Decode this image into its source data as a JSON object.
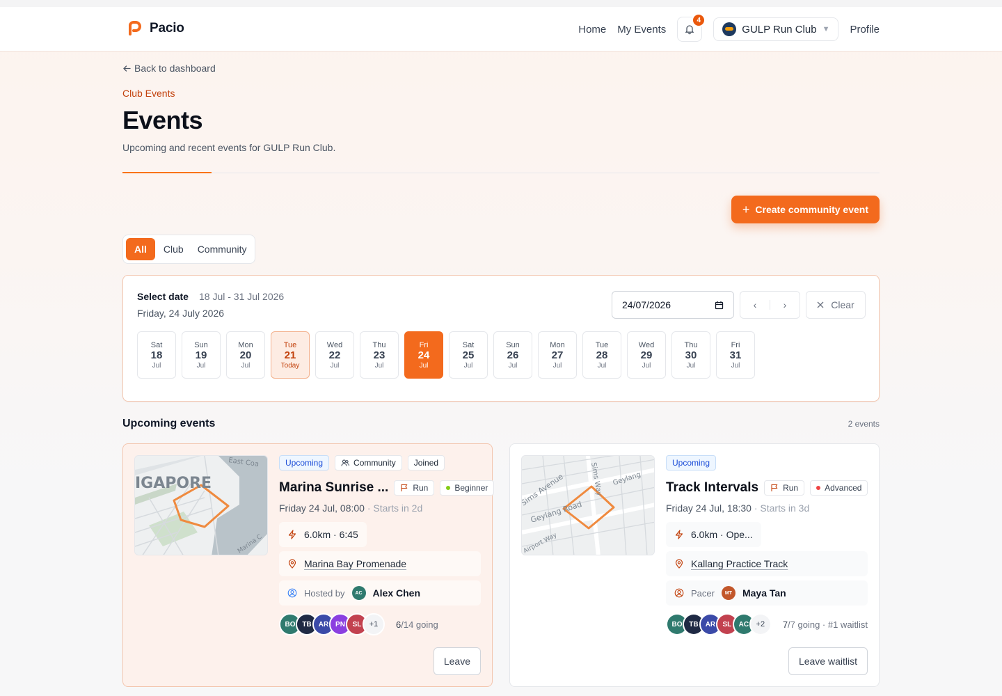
{
  "brand": {
    "name": "Pacio",
    "accent": "#f36a1d"
  },
  "nav": {
    "links": [
      "Home",
      "My Events"
    ],
    "notifications_count": "4",
    "club_name": "GULP Run Club",
    "profile": "Profile"
  },
  "header": {
    "back": "Back to dashboard",
    "eyebrow": "Club Events",
    "title": "Events",
    "subtitle": "Upcoming and recent events for GULP Run Club."
  },
  "actions": {
    "create": "Create community event"
  },
  "tabs": [
    {
      "label": "All",
      "active": true
    },
    {
      "label": "Club",
      "active": false
    },
    {
      "label": "Community",
      "active": false
    }
  ],
  "date_picker": {
    "label": "Select date",
    "range": "18 Jul - 31 Jul 2026",
    "selected": "Friday, 24 July 2026",
    "input_value": "24/07/2026",
    "clear": "Clear",
    "days": [
      {
        "dow": "Sat",
        "num": "18",
        "mon": "Jul"
      },
      {
        "dow": "Sun",
        "num": "19",
        "mon": "Jul"
      },
      {
        "dow": "Mon",
        "num": "20",
        "mon": "Jul"
      },
      {
        "dow": "Tue",
        "num": "21",
        "mon": "Today",
        "state": "today"
      },
      {
        "dow": "Wed",
        "num": "22",
        "mon": "Jul"
      },
      {
        "dow": "Thu",
        "num": "23",
        "mon": "Jul"
      },
      {
        "dow": "Fri",
        "num": "24",
        "mon": "Jul",
        "state": "active"
      },
      {
        "dow": "Sat",
        "num": "25",
        "mon": "Jul"
      },
      {
        "dow": "Sun",
        "num": "26",
        "mon": "Jul"
      },
      {
        "dow": "Mon",
        "num": "27",
        "mon": "Jul"
      },
      {
        "dow": "Tue",
        "num": "28",
        "mon": "Jul"
      },
      {
        "dow": "Wed",
        "num": "29",
        "mon": "Jul"
      },
      {
        "dow": "Thu",
        "num": "30",
        "mon": "Jul"
      },
      {
        "dow": "Fri",
        "num": "31",
        "mon": "Jul"
      }
    ]
  },
  "events_section": {
    "title": "Upcoming events",
    "count": "2 events"
  },
  "events": [
    {
      "map_labels": [
        "IGAPORE",
        "East Coa",
        "Marina C"
      ],
      "badges": {
        "status": "Upcoming",
        "type": "Community",
        "joined": "Joined"
      },
      "title": "Marina Sunrise ...",
      "activity": "Run",
      "level": "Beginner",
      "level_color": "#84cc16",
      "when": "Friday 24 Jul, 08:00",
      "starts_in": "· Starts in 2d",
      "stats": "6.0km · 6:45",
      "location": "Marina Bay Promenade",
      "host_label": "Hosted by",
      "host_initials": "AC",
      "host_name": "Alex Chen",
      "attendees": [
        {
          "initials": "BO",
          "color": "#2f7a6e"
        },
        {
          "initials": "TB",
          "color": "#1f2a44"
        },
        {
          "initials": "AR",
          "color": "#3b4aa8"
        },
        {
          "initials": "PN",
          "color": "#8b3fe0"
        },
        {
          "initials": "SL",
          "color": "#c2414f"
        }
      ],
      "attendees_more": "+1",
      "going_count": "6",
      "going_suffix": "/14 going",
      "action": "Leave"
    },
    {
      "map_labels": [
        "Sims Avenue",
        "Geylang Road",
        "Sims Way",
        "Geylang",
        "Airport Way"
      ],
      "badges": {
        "status": "Upcoming"
      },
      "title": "Track Intervals",
      "activity": "Run",
      "level": "Advanced",
      "level_color": "#ef4444",
      "when": "Friday 24 Jul, 18:30",
      "starts_in": "· Starts in 3d",
      "stats": "6.0km · Ope...",
      "location": "Kallang Practice Track",
      "host_label": "Pacer",
      "host_initials": "MT",
      "host_name": "Maya Tan",
      "attendees": [
        {
          "initials": "BO",
          "color": "#2f7a6e"
        },
        {
          "initials": "TB",
          "color": "#1f2a44"
        },
        {
          "initials": "AR",
          "color": "#3b4aa8"
        },
        {
          "initials": "SL",
          "color": "#c2414f"
        },
        {
          "initials": "AC",
          "color": "#2f7a6e"
        }
      ],
      "attendees_more": "+2",
      "going_count": "7",
      "going_suffix": "/7 going · #1 waitlist",
      "action": "Leave waitlist"
    }
  ]
}
